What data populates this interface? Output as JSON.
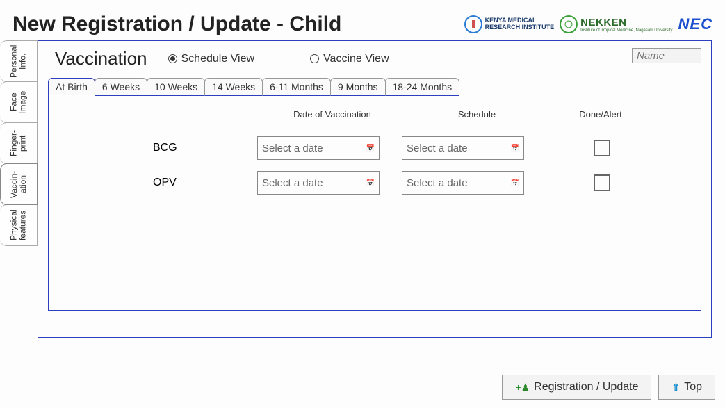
{
  "header": {
    "title": "New Registration / Update - Child",
    "logos": {
      "kemri_line1": "KENYA MEDICAL",
      "kemri_line2": "RESEARCH INSTITUTE",
      "nekken": "NEKKEN",
      "nekken_sub": "Institute of Tropical Medicine, Nagasaki University",
      "nec": "NEC"
    }
  },
  "sidetabs": [
    {
      "label": "Personal Info."
    },
    {
      "label": "Face Image"
    },
    {
      "label": "Finger- print"
    },
    {
      "label": "Vaccin- ation",
      "active": true
    },
    {
      "label": "Physical features"
    }
  ],
  "section": {
    "title": "Vaccination",
    "view_schedule": "Schedule View",
    "view_vaccine": "Vaccine View",
    "name_placeholder": "Name"
  },
  "htabs": [
    {
      "label": "At Birth",
      "active": true
    },
    {
      "label": "6 Weeks"
    },
    {
      "label": "10 Weeks"
    },
    {
      "label": "14 Weeks"
    },
    {
      "label": "6-11 Months"
    },
    {
      "label": "9 Months"
    },
    {
      "label": "18-24 Months"
    }
  ],
  "columns": {
    "date": "Date of Vaccination",
    "schedule": "Schedule",
    "done": "Done/Alert"
  },
  "rows": [
    {
      "name": "BCG",
      "date_ph": "Select a date",
      "sched_ph": "Select a date"
    },
    {
      "name": "OPV",
      "date_ph": "Select a date",
      "sched_ph": "Select a date"
    }
  ],
  "footer": {
    "register": "Registration / Update",
    "top": "Top"
  }
}
